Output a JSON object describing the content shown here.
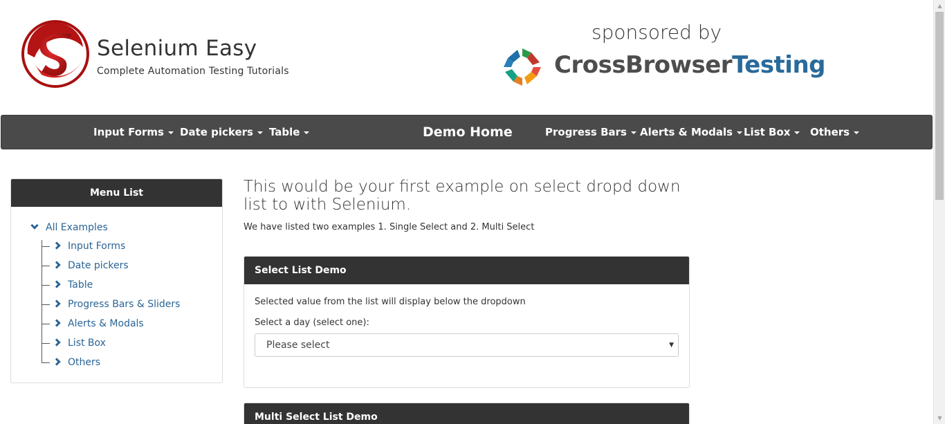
{
  "header": {
    "brand_title": "Selenium Easy",
    "brand_subtitle": "Complete Automation Testing Tutorials",
    "sponsor_text": "sponsored by",
    "sponsor_name_part1": "CrossBrowser",
    "sponsor_name_part2": "Testing"
  },
  "navbar": {
    "brand": "Demo Home",
    "left_items": [
      "Input Forms",
      "Date pickers",
      "Table"
    ],
    "right_items": [
      "Progress Bars",
      "Alerts & Modals",
      "List Box",
      "Others"
    ]
  },
  "sidebar": {
    "title": "Menu List",
    "root": "All Examples",
    "items": [
      "Input Forms",
      "Date pickers",
      "Table",
      "Progress Bars & Sliders",
      "Alerts & Modals",
      "List Box",
      "Others"
    ]
  },
  "main": {
    "title": "This would be your first example on select dropd down list to with Selenium.",
    "description": "We have listed two examples 1. Single Select and 2. Multi Select"
  },
  "select_panel": {
    "title": "Select List Demo",
    "info_text": "Selected value from the list will display below the dropdown",
    "label": "Select a day (select one):",
    "selected_value": "Please select"
  },
  "multi_panel": {
    "title": "Multi Select List Demo"
  },
  "colors": {
    "navbar_bg": "#4a4a4a",
    "panel_head_bg": "#333333",
    "link_blue": "#2a6496",
    "brand_red": "#c4161c"
  }
}
